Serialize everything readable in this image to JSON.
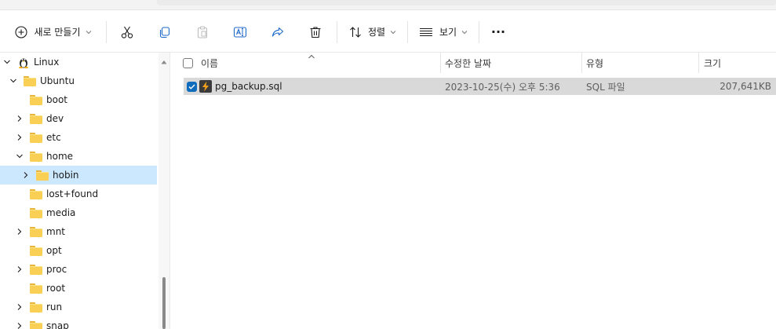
{
  "toolbar": {
    "new_label": "새로 만들기",
    "sort_label": "정렬",
    "view_label": "보기",
    "more_label": "···"
  },
  "nav": {
    "items": [
      {
        "label": "Linux",
        "expanded": true,
        "icon": "linux-penguin-icon"
      },
      {
        "label": "Ubuntu",
        "expanded": true,
        "icon": "folder-icon"
      },
      {
        "label": "boot",
        "icon": "folder-icon"
      },
      {
        "label": "dev",
        "icon": "folder-icon"
      },
      {
        "label": "etc",
        "icon": "folder-icon"
      },
      {
        "label": "home",
        "expanded": true,
        "icon": "folder-icon"
      },
      {
        "label": "hobin",
        "selected": true,
        "icon": "folder-icon"
      },
      {
        "label": "lost+found",
        "icon": "folder-icon"
      },
      {
        "label": "media",
        "icon": "folder-icon"
      },
      {
        "label": "mnt",
        "icon": "folder-icon"
      },
      {
        "label": "opt",
        "icon": "folder-icon"
      },
      {
        "label": "proc",
        "icon": "folder-icon"
      },
      {
        "label": "root",
        "icon": "folder-icon"
      },
      {
        "label": "run",
        "icon": "folder-icon"
      },
      {
        "label": "snap",
        "icon": "folder-icon"
      }
    ]
  },
  "list": {
    "columns": {
      "name": "이름",
      "modified": "수정한 날짜",
      "type": "유형",
      "size": "크기"
    },
    "rows": [
      {
        "name": "pg_backup.sql",
        "modified": "2023-10-25(수) 오후 5:36",
        "type": "SQL 파일",
        "size": "207,641KB",
        "checked": true
      }
    ]
  },
  "colors": {
    "selection": "#cce8ff",
    "row_selected": "#d9d9d9",
    "accent": "#0f6cbd",
    "folder": "#f9cf55"
  }
}
